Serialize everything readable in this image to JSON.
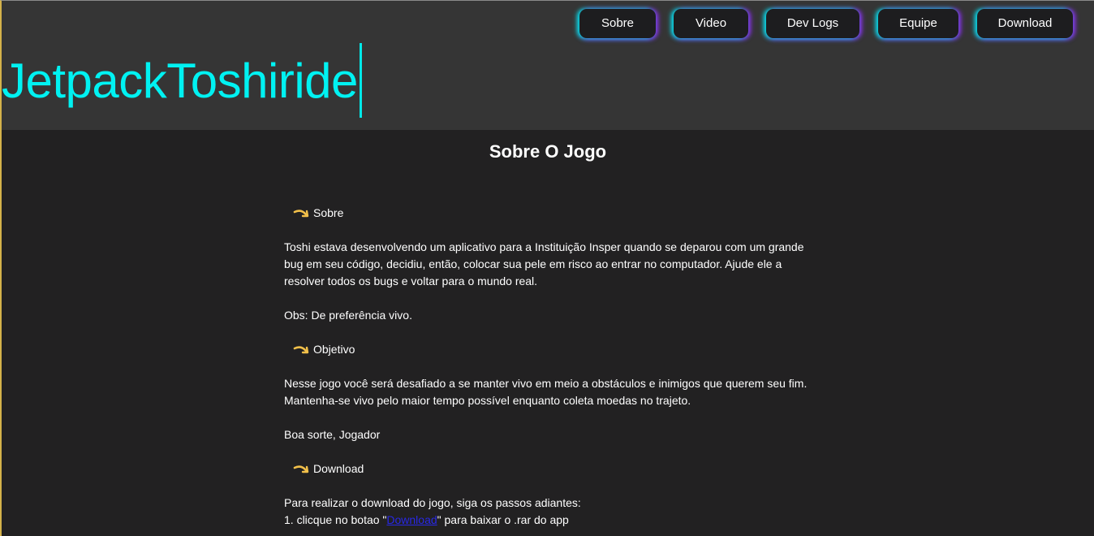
{
  "header": {
    "logo": "JetpackToshiride"
  },
  "nav": {
    "items": [
      {
        "label": "Sobre"
      },
      {
        "label": "Video"
      },
      {
        "label": "Dev Logs"
      },
      {
        "label": "Equipe"
      },
      {
        "label": "Download"
      }
    ]
  },
  "main": {
    "title": "Sobre O Jogo",
    "sections": {
      "sobre": {
        "heading": "Sobre",
        "p1": "Toshi estava desenvolvendo um aplicativo para a Instituição Insper quando se deparou com um grande bug em seu código, decidiu, então, colocar sua pele em risco ao entrar no computador. Ajude ele a resolver todos os bugs e voltar para o mundo real.",
        "p2": "Obs: De preferência vivo."
      },
      "objetivo": {
        "heading": "Objetivo",
        "p1": "Nesse jogo você será desafiado a se manter vivo em meio a obstáculos e inimigos que querem seu fim. Mantenha-se vivo pelo maior tempo possível enquanto coleta moedas no trajeto.",
        "p2": "Boa sorte, Jogador"
      },
      "download": {
        "heading": "Download",
        "intro": "Para realizar o download do jogo, siga os passos adiantes:",
        "step1_prefix": "1. clicque no botao \"",
        "step1_link": "Download",
        "step1_suffix": "\" para baixar o .rar do app"
      }
    }
  },
  "colors": {
    "logo": "#00f2f2",
    "header_bg": "#353535",
    "body_bg": "#222122",
    "button_bg": "#1d1d1f",
    "arrow_icon": "#f2c04a"
  }
}
